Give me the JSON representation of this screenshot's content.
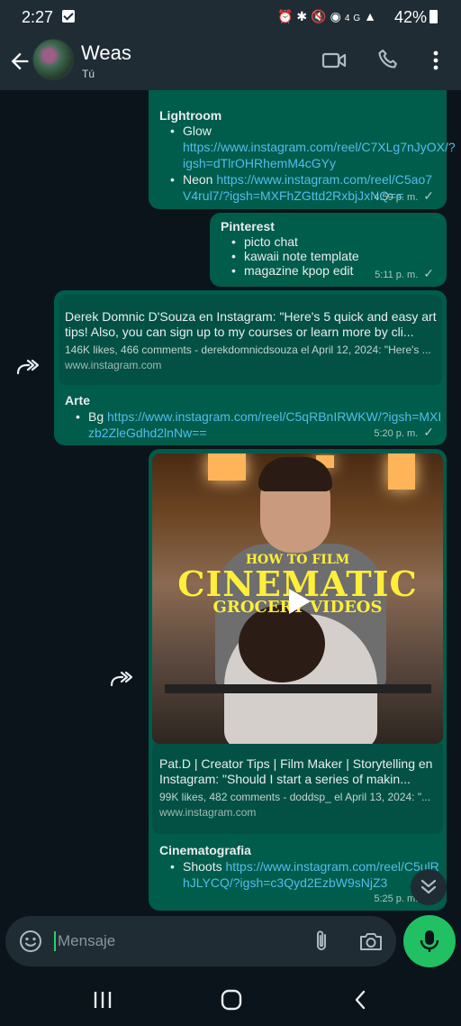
{
  "status_bar": {
    "time": "2:27",
    "network": "4G",
    "battery": "42%"
  },
  "header": {
    "contact_name": "Weas",
    "contact_sub": "Tú"
  },
  "messages": {
    "m1": {
      "heading": "Lightroom",
      "items": [
        {
          "label": "Glow ",
          "link": "https://www.instagram.com/reel/C7XLg7nJyOX/?igsh=dTlrOHRhemM4cGYy"
        },
        {
          "label": "Neon ",
          "link": "https://www.instagram.com/reel/C5ao7V4rul7/?igsh=MXFhZGttd2RxbjJxNQ=="
        }
      ],
      "time": "4:59 p. m."
    },
    "m2": {
      "heading": "Pinterest",
      "items": [
        "picto chat",
        "kawaii note template",
        "magazine kpop edit"
      ],
      "time": "5:11 p. m."
    },
    "m3": {
      "preview_title": "Derek Domnic D'Souza en Instagram: \"Here's 5 quick and easy art tips! Also, you can sign up to my courses or learn more by cli...",
      "preview_desc": "146K likes, 466 comments - derekdomnicdsouza el April 12, 2024: \"Here's ...",
      "preview_url": "www.instagram.com",
      "heading": "Arte",
      "item_label": "Bg ",
      "item_link": "https://www.instagram.com/reel/C5qRBnIRWKW/?igsh=MXIzb2ZleGdhd2lnNw==",
      "time": "5:20 p. m."
    },
    "m4": {
      "thumb_text_1": "HOW TO FILM",
      "thumb_text_2": "CINEMATIC",
      "thumb_text_3": "GROCERY VIDEOS",
      "preview_title": "Pat.D | Creator Tips | Film Maker | Storytelling en Instagram: \"Should I start a series of makin...",
      "preview_desc": "99K likes, 482 comments - doddsp_ el April 13, 2024: \"...",
      "preview_url": "www.instagram.com",
      "heading": "Cinematografia",
      "item_label": "Shoots ",
      "item_link": "https://www.instagram.com/reel/C5ulRhJLYCQ/?igsh=c3Qyd2EzbW9sNjZ3",
      "time": "5:25 p. m."
    }
  },
  "composer": {
    "placeholder": "Mensaje"
  },
  "colors": {
    "outgoing_bubble": "#005c4b",
    "link": "#53bdeb",
    "accent": "#21c063",
    "background": "#0b141a"
  }
}
